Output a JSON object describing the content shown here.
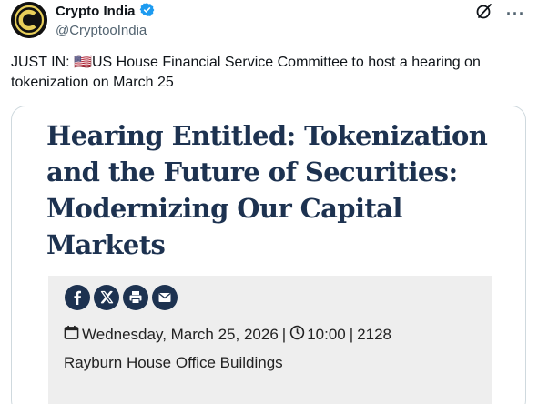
{
  "author": {
    "name": "Crypto India",
    "handle": "@CryptooIndia",
    "verified": true
  },
  "actions": {
    "more": "···"
  },
  "tweet": {
    "text": "JUST IN: 🇺🇸US House Financial Service Committee to host a hearing on tokenization on March 25"
  },
  "card": {
    "title": "Hearing Entitled: Tokenization and the Future of Securities: Modernizing Our Capital Markets",
    "share_icons": [
      "facebook-icon",
      "x-icon",
      "print-icon",
      "email-icon"
    ],
    "date": "Wednesday, March 25, 2026",
    "separator": "|",
    "time": "10:00",
    "room": "2128",
    "location": "Rayburn House Office Buildings"
  },
  "colors": {
    "headline": "#1d3250",
    "verified": "#1d9bf0",
    "info_bg": "#eeeeee"
  }
}
